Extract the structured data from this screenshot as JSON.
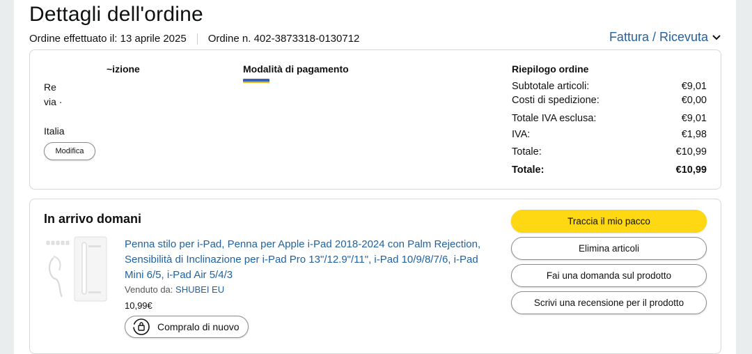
{
  "header": {
    "title": "Dettagli dell'ordine",
    "order_date": "Ordine effettuato il: 13 aprile 2025",
    "order_number": "Ordine n. 402-3873318-0130712",
    "invoice_link": "Fattura / Ricevuta",
    "invoice_icon": "chevron-down-icon"
  },
  "shipping": {
    "heading": "~izione",
    "line1": "Re",
    "line2": "via ·",
    "country": "Italia",
    "edit_button": "Modifica"
  },
  "payment": {
    "heading": "Modalità di pagamento",
    "card_icon": "credit-card-icon"
  },
  "summary": {
    "heading": "Riepilogo ordine",
    "rows": [
      {
        "label": "Subtotale articoli:",
        "value": "€9,01"
      },
      {
        "label": "Costi di spedizione:",
        "value": "€0,00"
      },
      {
        "label": "Totale IVA esclusa:",
        "value": "€9,01"
      },
      {
        "label": "IVA:",
        "value": "€1,98"
      },
      {
        "label": "Totale:",
        "value": "€10,99"
      },
      {
        "label": "Totale:",
        "value": "€10,99"
      }
    ]
  },
  "shipment": {
    "status": "In arrivo domani",
    "product_title": "Penna stilo per i-Pad, Penna per Apple i-Pad 2018-2024 con Palm Rejection, Sensibilità di Inclinazione per i-Pad Pro 13\"/12.9\"/11\", i-Pad 10/9/8/7/6, i-Pad Mini 6/5, i-Pad Air 5/4/3",
    "seller_label": "Venduto da:",
    "seller_name": "SHUBEI EU",
    "price": "10,99€",
    "buy_again": "Compralo di nuovo",
    "buy_again_icon": "reorder-icon"
  },
  "actions": {
    "track": "Traccia il mio pacco",
    "remove": "Elimina articoli",
    "question": "Fai una domanda sul prodotto",
    "review": "Scrivi una recensione per il prodotto"
  },
  "colors": {
    "link": "#2162a1",
    "primary_button": "#ffd814",
    "border": "#d5d9d9",
    "background": "#eaeded"
  }
}
